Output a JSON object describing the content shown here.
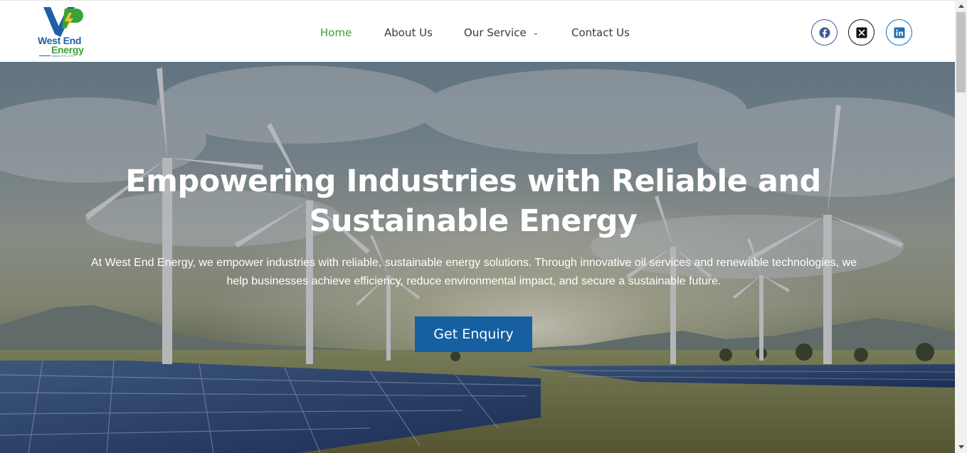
{
  "brand": {
    "name": "West End",
    "name_line2": "Energy",
    "tagline": "INDIA PVT LTD",
    "colors": {
      "blue": "#1f5ea8",
      "green": "#3aa335"
    }
  },
  "nav": {
    "items": [
      {
        "label": "Home",
        "active": true
      },
      {
        "label": "About Us",
        "active": false
      },
      {
        "label": "Our Service",
        "active": false,
        "has_dropdown": true
      },
      {
        "label": "Contact Us",
        "active": false
      }
    ],
    "active_color": "#3aa335"
  },
  "social": [
    {
      "name": "facebook-icon"
    },
    {
      "name": "x-icon"
    },
    {
      "name": "linkedin-icon"
    }
  ],
  "hero": {
    "title_line1": "Empowering Industries with Reliable and",
    "title_line2": "Sustainable Energy",
    "text_line1": "At West End Energy, we empower industries with reliable, sustainable energy solutions. Through innovative oil services and renewable technologies, we",
    "text_line2": "help businesses achieve efficiency, reduce environmental impact, and secure a sustainable future.",
    "button_label": "Get Enquiry",
    "button_color": "#165fa0"
  }
}
